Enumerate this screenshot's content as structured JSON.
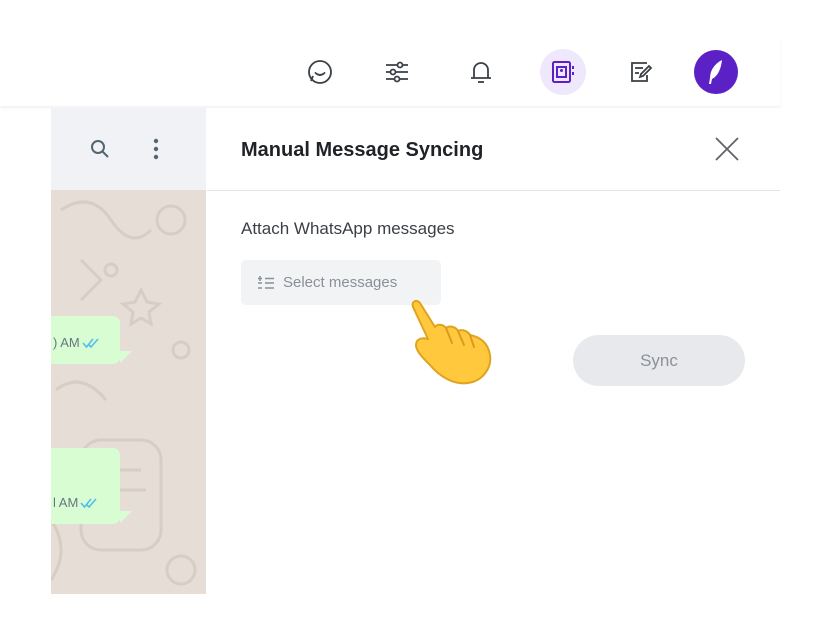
{
  "toolbar": {
    "icons": [
      "chat-bubble-icon",
      "sliders-icon",
      "bell-icon",
      "contact-book-icon",
      "note-edit-icon"
    ],
    "active_icon": "contact-book-icon",
    "avatar_icon": "feather-icon"
  },
  "chat": {
    "header_icons": [
      "search-icon",
      "kebab-menu-icon"
    ],
    "messages": [
      {
        "time": ") AM",
        "status": "double-check-icon"
      },
      {
        "time": "l AM",
        "status": "double-check-icon"
      }
    ]
  },
  "panel": {
    "title": "Manual Message Syncing",
    "close_icon": "close-icon",
    "section_label": "Attach WhatsApp messages",
    "select_button": {
      "label": "Select messages",
      "icon": "list-icon"
    },
    "sync_button": {
      "label": "Sync"
    }
  },
  "overlay": {
    "cursor_icon": "pointing-hand-icon"
  },
  "colors": {
    "accent": "#5b21c7",
    "active_bg": "#efe8fd",
    "bubble": "#d9fdd3",
    "check": "#53bdeb",
    "chat_bg": "#e6ded6"
  }
}
